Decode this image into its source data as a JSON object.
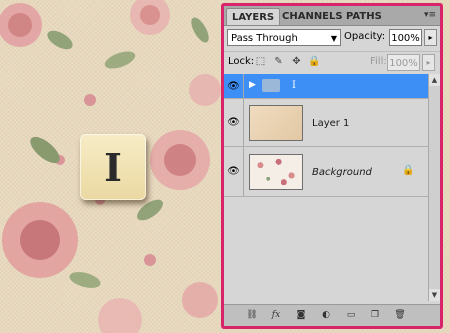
{
  "canvas": {
    "tile_letter": "I"
  },
  "panel": {
    "tabs": [
      "LAYERS",
      "CHANNELS",
      "PATHS"
    ],
    "active_tab": "LAYERS",
    "blend_mode": "Pass Through",
    "opacity_label": "Opacity:",
    "opacity_value": "100%",
    "lock_label": "Lock:",
    "fill_label": "Fill:",
    "fill_value": "100%",
    "layers": [
      {
        "name": "I",
        "type": "group",
        "visible": true,
        "selected": true
      },
      {
        "name": "Layer 1",
        "type": "layer",
        "visible": true,
        "selected": false
      },
      {
        "name": "Background",
        "type": "background",
        "visible": true,
        "locked": true,
        "selected": false
      }
    ],
    "footer_icons": [
      "link-icon",
      "fx-icon",
      "mask-icon",
      "adjustment-icon",
      "folder-icon",
      "new-layer-icon",
      "trash-icon"
    ]
  },
  "colors": {
    "accent_border": "#d8246a",
    "selected_row": "#3d8ef5",
    "panel_bg": "#d6d6d6"
  }
}
